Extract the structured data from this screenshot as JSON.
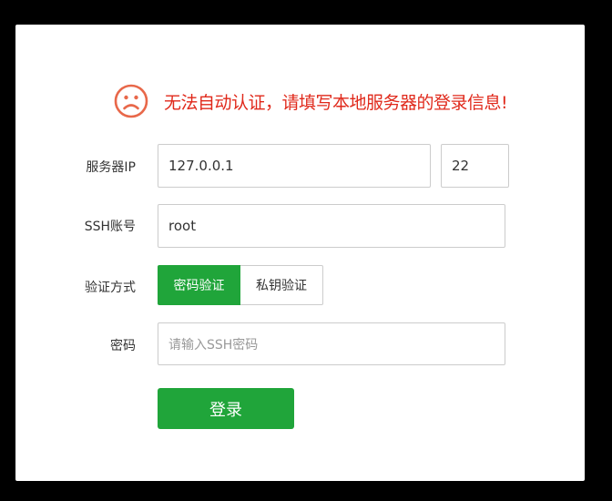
{
  "alert": {
    "icon": "sad-face-icon",
    "message": "无法自动认证，请填写本地服务器的登录信息!",
    "color": "#e0291b"
  },
  "form": {
    "server_ip_label": "服务器IP",
    "server_ip_value": "127.0.0.1",
    "port_value": "22",
    "ssh_account_label": "SSH账号",
    "ssh_account_value": "root",
    "auth_method_label": "验证方式",
    "auth_methods": [
      "密码验证",
      "私钥验证"
    ],
    "auth_selected": "密码验证",
    "password_label": "密码",
    "password_placeholder": "请输入SSH密码",
    "login_label": "登录"
  },
  "colors": {
    "accent": "#20a53a",
    "border": "#cccccc",
    "backdrop": "#000000"
  }
}
